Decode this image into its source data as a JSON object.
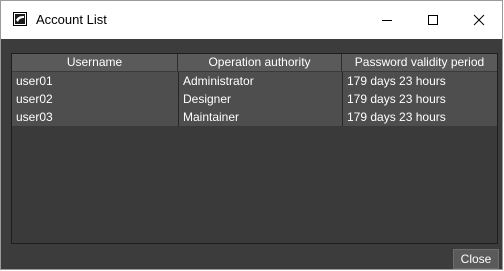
{
  "window": {
    "title": "Account List",
    "icon": "app-logo-icon",
    "controls": {
      "minimize_icon": "minimize-icon",
      "maximize_icon": "maximize-icon",
      "close_icon": "close-icon"
    }
  },
  "table": {
    "columns": [
      "Username",
      "Operation authority",
      "Password validity period"
    ],
    "rows": [
      [
        "user01",
        "Administrator",
        "179 days 23 hours"
      ],
      [
        "user02",
        "Designer",
        "179 days 23 hours"
      ],
      [
        "user03",
        "Maintainer",
        "179 days 23 hours"
      ]
    ]
  },
  "footer": {
    "close_label": "Close"
  },
  "colors": {
    "background": "#3c3c3c",
    "header": "#5a5a5a",
    "row": "#4e4e4e",
    "text": "#ffffff"
  }
}
